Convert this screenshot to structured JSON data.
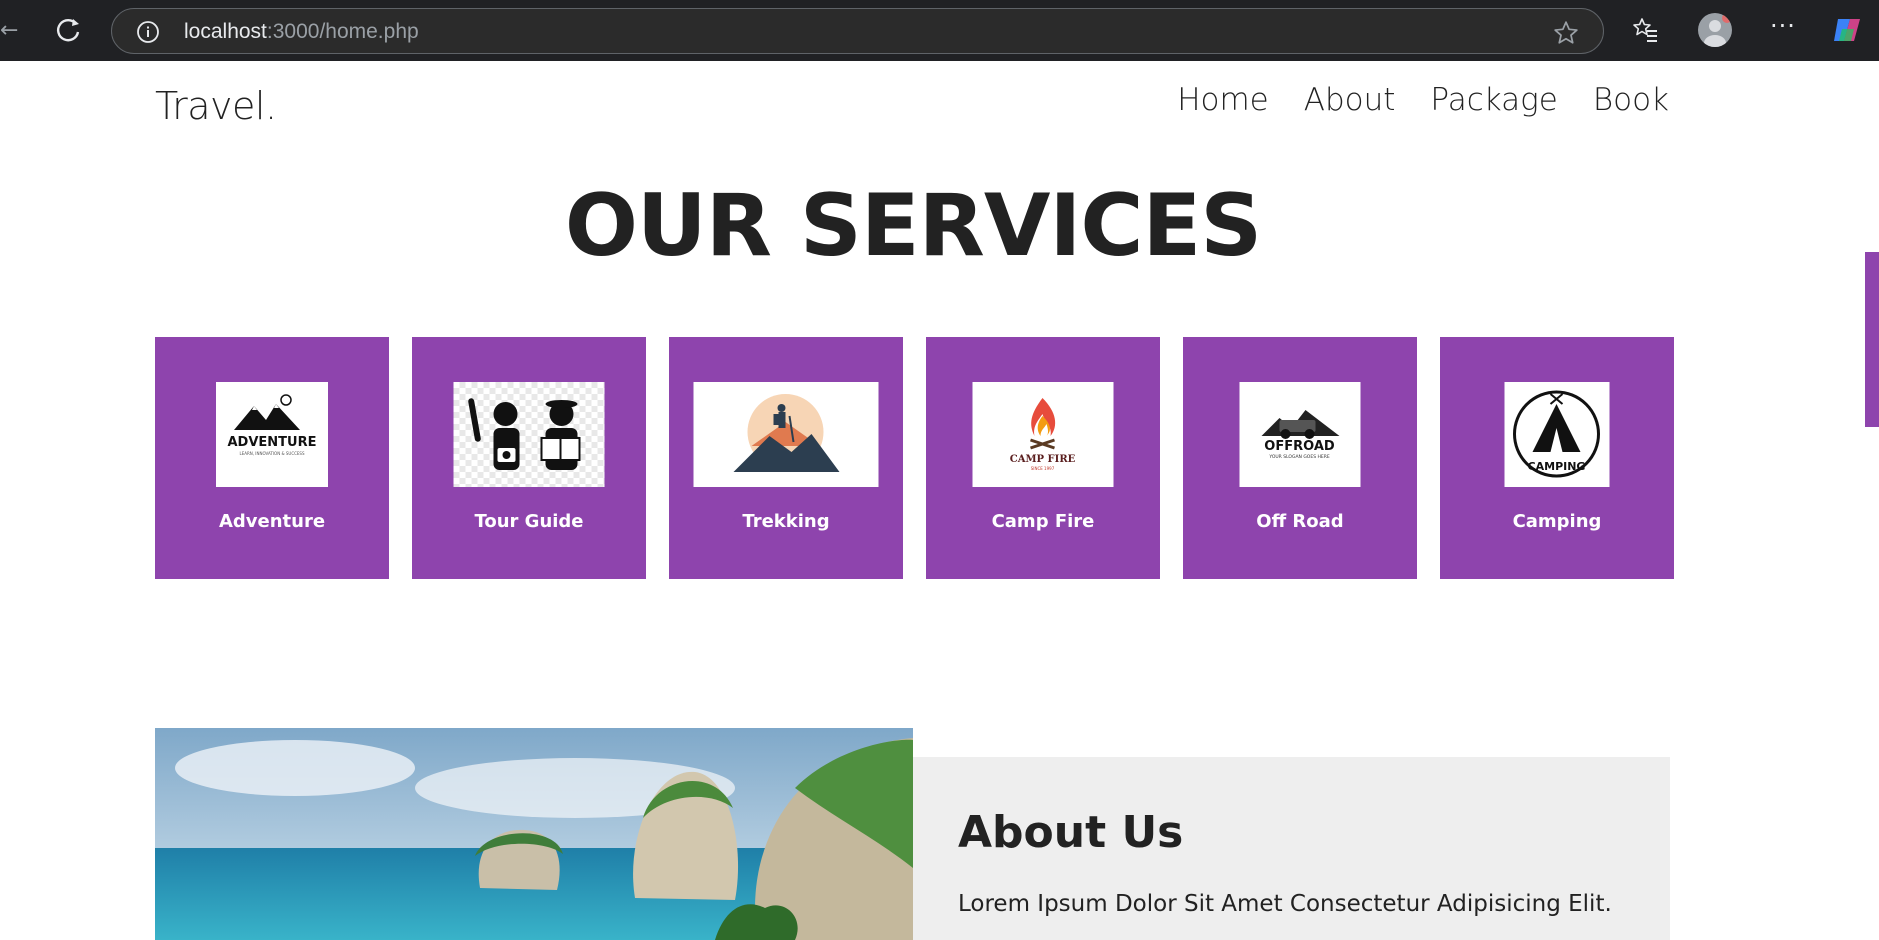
{
  "browser": {
    "url_host": "localhost",
    "url_rest": ":3000/home.php"
  },
  "header": {
    "logo": "Travel.",
    "nav": [
      "Home",
      "About",
      "Package",
      "Book"
    ]
  },
  "services": {
    "title": "OUR SERVICES",
    "cards": [
      {
        "label": "Adventure",
        "logo_text": "ADVENTURE",
        "logo_sub": "LEARN, INNOVATION & SUCCESS"
      },
      {
        "label": "Tour Guide"
      },
      {
        "label": "Trekking"
      },
      {
        "label": "Camp Fire",
        "logo_text": "CAMP FIRE",
        "logo_sub": "SINCE 1997"
      },
      {
        "label": "Off Road",
        "logo_text": "OFFROAD",
        "logo_sub": "YOUR SLOGAN GOES HERE"
      },
      {
        "label": "Camping",
        "logo_text": "CAMPING"
      }
    ]
  },
  "about": {
    "title": "About Us",
    "text": "Lorem Ipsum Dolor Sit Amet Consectetur Adipisicing Elit."
  },
  "colors": {
    "accent": "#8e44ad",
    "chrome_bg": "#202124",
    "about_bg": "#eeeeee"
  }
}
